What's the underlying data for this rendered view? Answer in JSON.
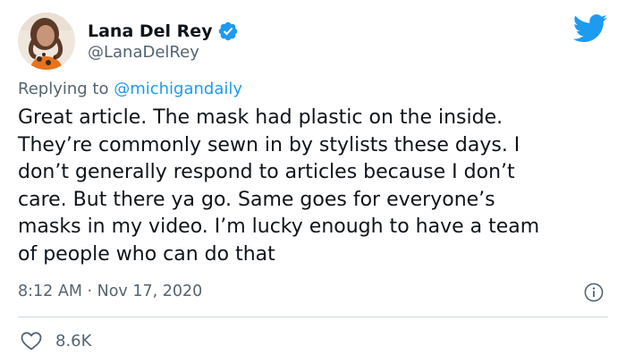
{
  "author": {
    "display_name": "Lana Del Rey",
    "handle": "@LanaDelRey",
    "verified": true
  },
  "reply": {
    "prefix": "Replying to ",
    "mention": "@michigandaily"
  },
  "tweet": {
    "text": "Great article. The mask had plastic on the inside.\nThey’re commonly sewn in by stylists these days. I\ndon’t generally respond to articles because I don’t\ncare. But there ya go. Same goes for everyone’s\nmasks in my video. I’m lucky enough to have a team\nof people who can do that",
    "timestamp": "8:12 AM · Nov 17, 2020"
  },
  "engagement": {
    "likes": "8.6K"
  },
  "icons": {
    "brand": "twitter-bird-icon",
    "verified": "verified-badge-icon",
    "info": "info-icon",
    "like": "heart-icon"
  },
  "colors": {
    "brand_blue": "#1d9bf0",
    "text_primary": "#0f1419",
    "text_secondary": "#536471",
    "divider": "#cfd9de"
  }
}
